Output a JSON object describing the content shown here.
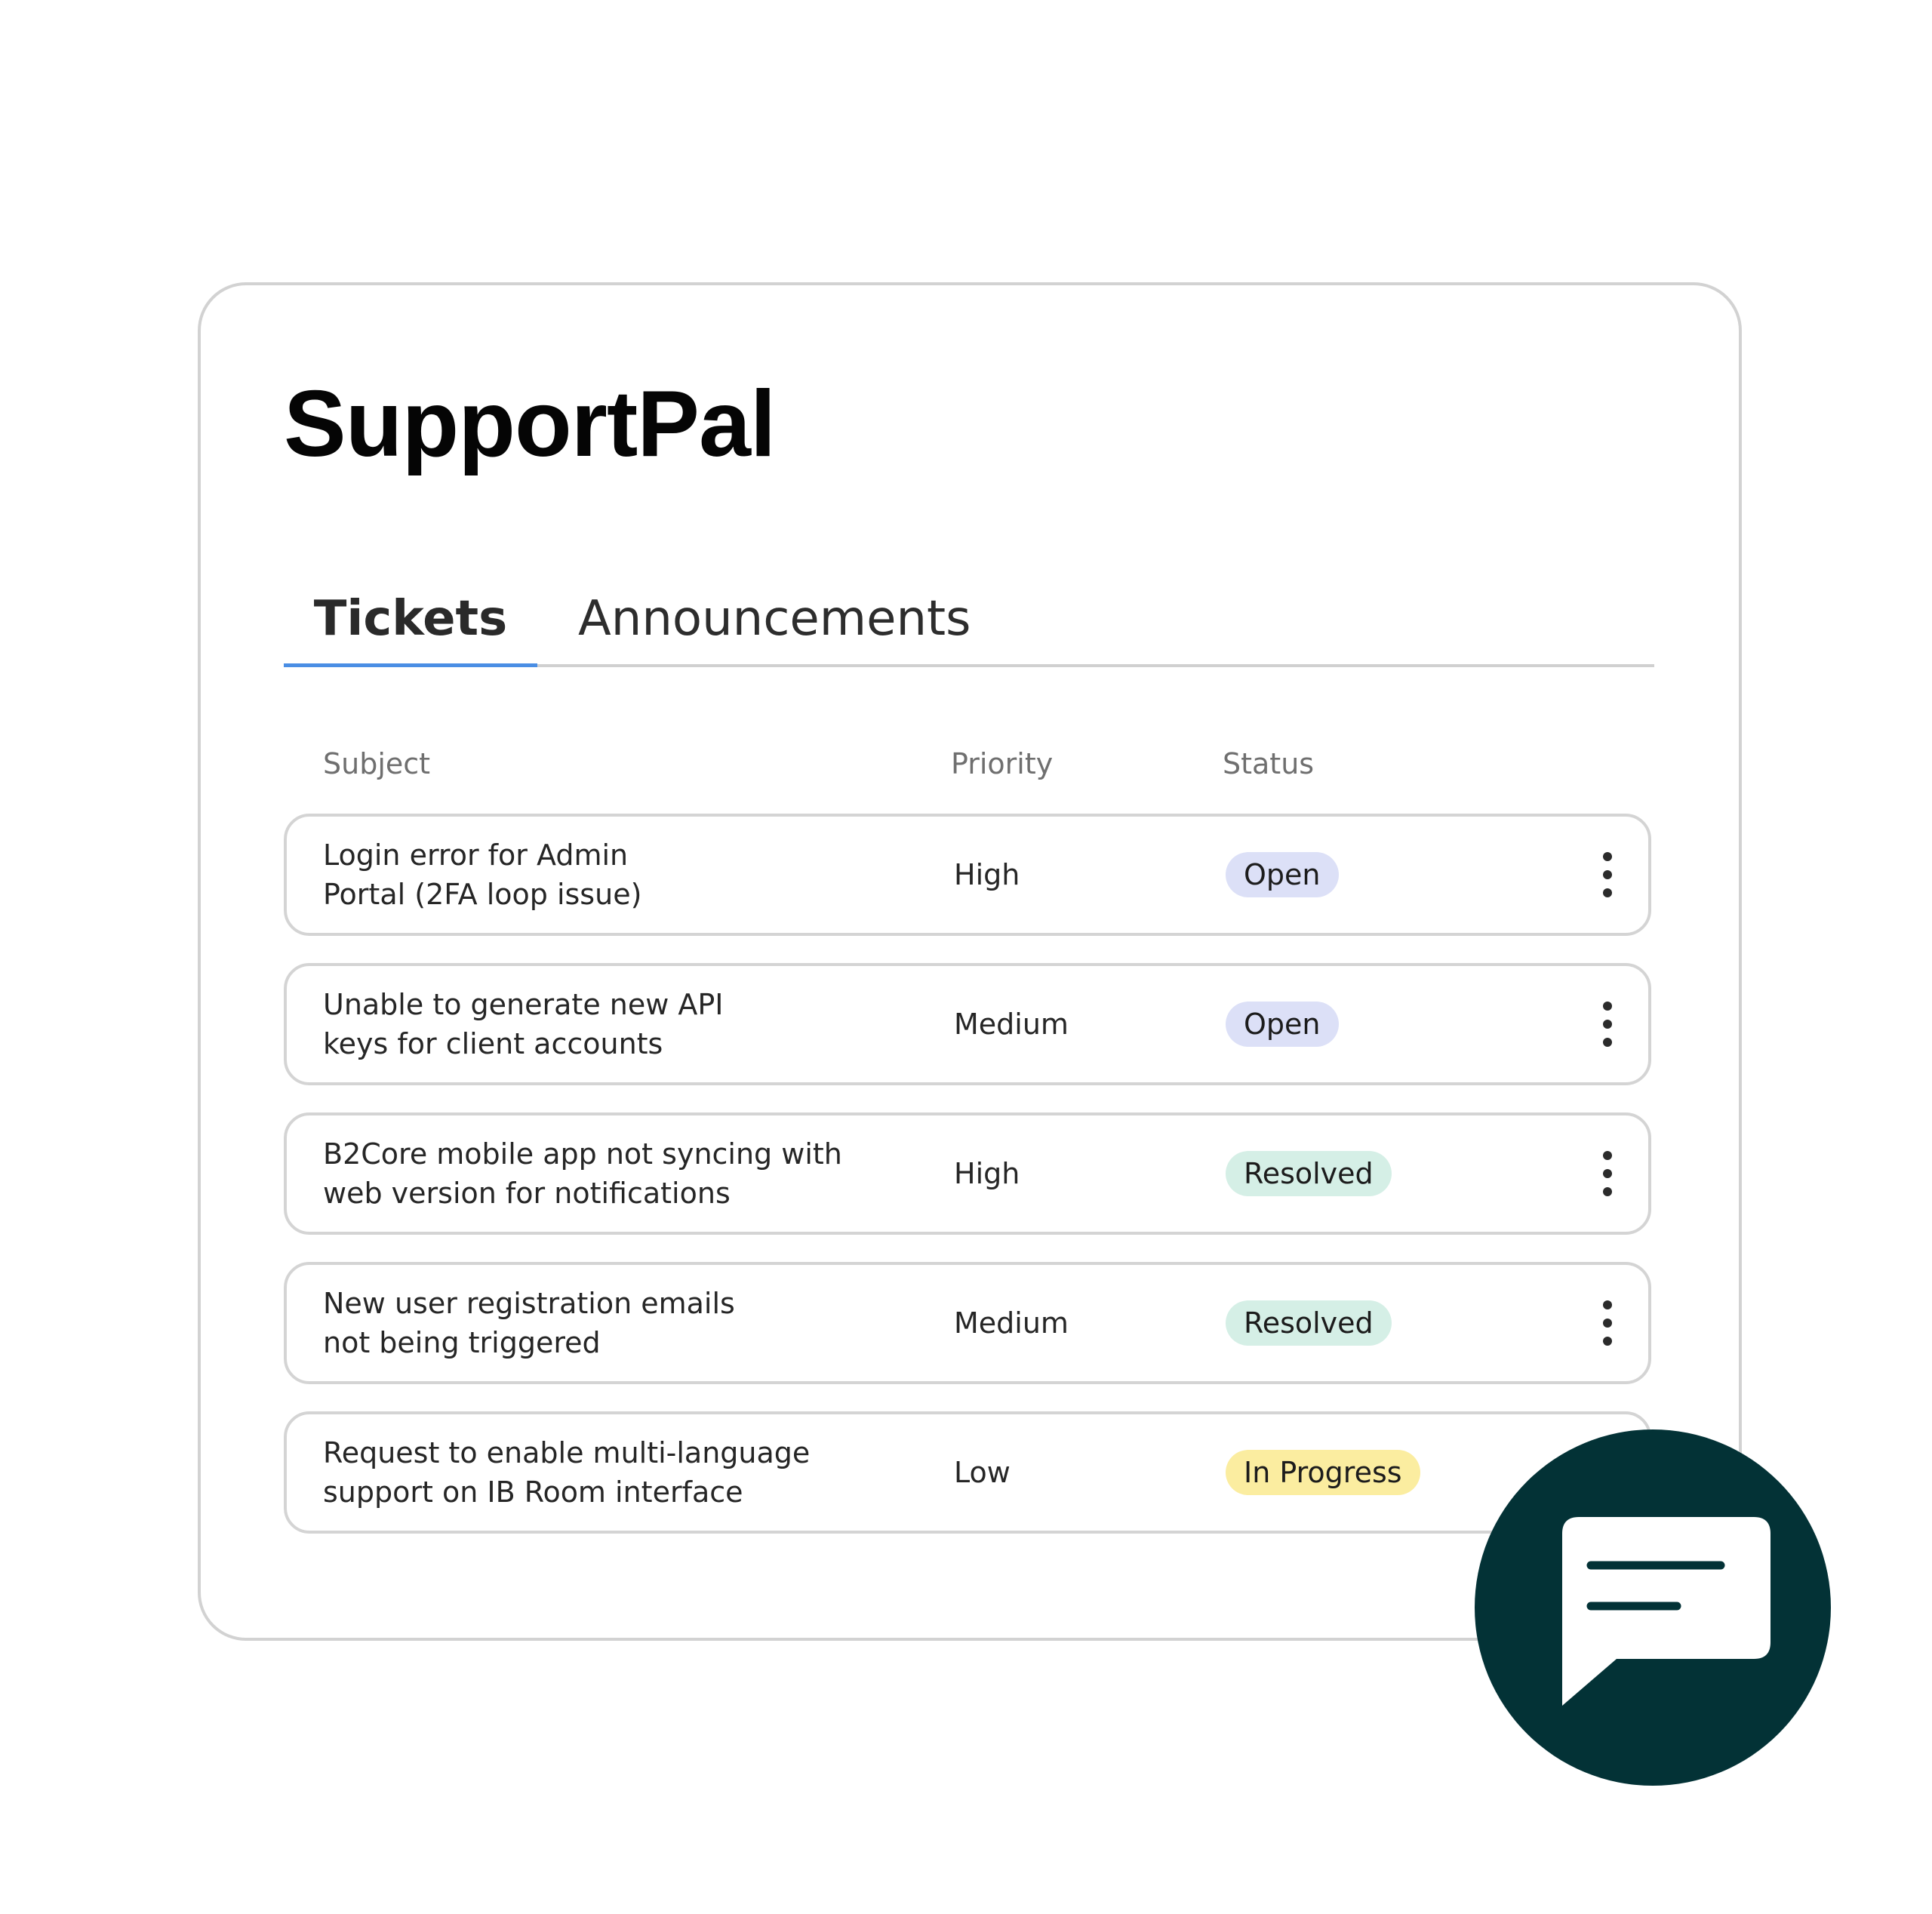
{
  "app": {
    "title": "SupportPal"
  },
  "tabs": [
    {
      "label": "Tickets",
      "active": true
    },
    {
      "label": "Announcements",
      "active": false
    }
  ],
  "table": {
    "columns": [
      "Subject",
      "Priority",
      "Status"
    ],
    "rows": [
      {
        "subject_line1": "Login error for Admin",
        "subject_line2": "Portal (2FA loop issue)",
        "priority": "High",
        "status": "Open",
        "status_type": "open"
      },
      {
        "subject_line1": "Unable to generate new API",
        "subject_line2": "keys for client accounts",
        "priority": "Medium",
        "status": "Open",
        "status_type": "open"
      },
      {
        "subject_line1": "B2Core mobile app not syncing with",
        "subject_line2": "web version for notifications",
        "priority": "High",
        "status": "Resolved",
        "status_type": "resolved"
      },
      {
        "subject_line1": "New user registration emails",
        "subject_line2": "not being triggered",
        "priority": "Medium",
        "status": "Resolved",
        "status_type": "resolved"
      },
      {
        "subject_line1": "Request to enable multi-language",
        "subject_line2": "support on IB Room interface",
        "priority": "Low",
        "status": "In Progress",
        "status_type": "progress"
      }
    ]
  },
  "icons": {
    "row_menu": "more-vertical-icon",
    "chat_button": "chat-bubble-icon"
  },
  "colors": {
    "tab_active_underline": "#4a8ee4",
    "status_open_bg": "#dce0f7",
    "status_resolved_bg": "#d5efe6",
    "status_in_progress_bg": "#fbeda0",
    "chat_fab_bg": "#033236"
  }
}
